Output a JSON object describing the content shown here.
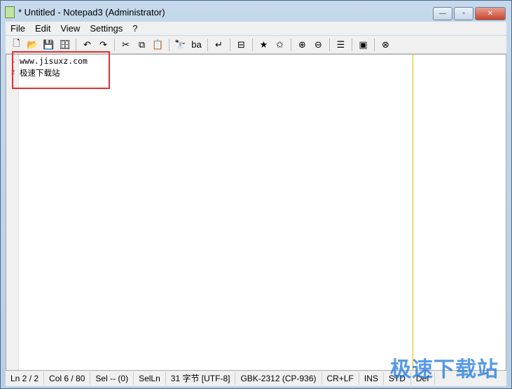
{
  "window": {
    "title": "* Untitled - Notepad3 (Administrator)",
    "minimize": "—",
    "maximize": "▫",
    "close": "✕"
  },
  "menu": [
    "File",
    "Edit",
    "View",
    "Settings",
    "?"
  ],
  "toolbar": [
    {
      "name": "new-icon",
      "glyph": "🗋"
    },
    {
      "name": "open-icon",
      "glyph": "📂"
    },
    {
      "name": "save-icon",
      "glyph": "💾"
    },
    {
      "name": "save-as-icon",
      "glyph": "🗄"
    },
    "sep",
    {
      "name": "undo-icon",
      "glyph": "↶"
    },
    {
      "name": "redo-icon",
      "glyph": "↷"
    },
    "sep",
    {
      "name": "cut-icon",
      "glyph": "✂"
    },
    {
      "name": "copy-icon",
      "glyph": "⧉"
    },
    {
      "name": "paste-icon",
      "glyph": "📋"
    },
    "sep",
    {
      "name": "find-icon",
      "glyph": "🔭"
    },
    {
      "name": "replace-icon",
      "glyph": "ba"
    },
    "sep",
    {
      "name": "word-wrap-icon",
      "glyph": "↵"
    },
    "sep",
    {
      "name": "split-icon",
      "glyph": "⊟"
    },
    "sep",
    {
      "name": "favorites-icon",
      "glyph": "★"
    },
    {
      "name": "add-favorite-icon",
      "glyph": "✩"
    },
    "sep",
    {
      "name": "zoom-in-icon",
      "glyph": "⊕"
    },
    {
      "name": "zoom-out-icon",
      "glyph": "⊖"
    },
    "sep",
    {
      "name": "schemes-icon",
      "glyph": "☰"
    },
    "sep",
    {
      "name": "terminal-icon",
      "glyph": "▣"
    },
    "sep",
    {
      "name": "exit-icon",
      "glyph": "⊗"
    }
  ],
  "editor": {
    "lines": [
      {
        "num": "1",
        "text": "www.jisuxz.com"
      },
      {
        "num": "2",
        "text": "极速下载站"
      }
    ]
  },
  "status": [
    "Ln 2 / 2",
    "Col 6 / 80",
    "Sel -- (0)",
    "SelLn",
    "31 字节 [UTF-8]",
    "GBK-2312 (CP-936)",
    "CR+LF",
    "INS",
    "STD",
    "Def"
  ],
  "watermark": "极速下载站"
}
